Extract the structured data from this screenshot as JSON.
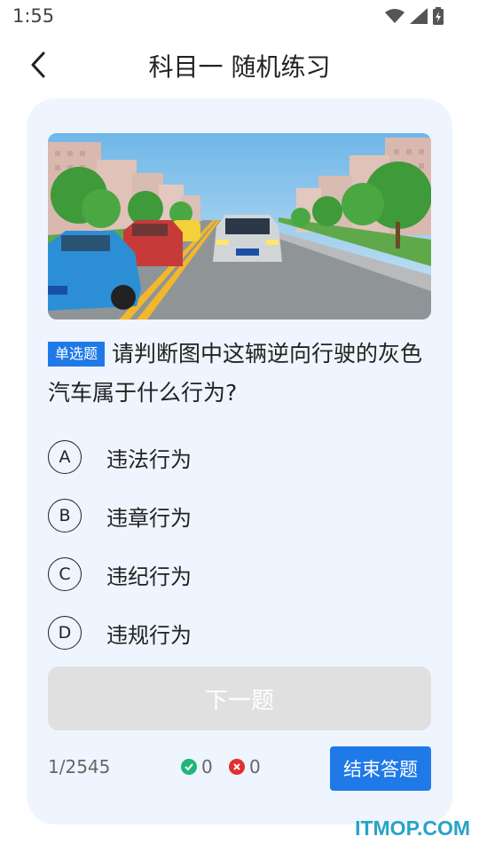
{
  "status_bar": {
    "time": "1:55",
    "icons": [
      "wifi-icon",
      "signal-icon",
      "battery-icon"
    ]
  },
  "header": {
    "title": "科目一 随机练习",
    "back_icon": "chevron-left-icon"
  },
  "question": {
    "type_tag": "单选题",
    "text": "请判断图中这辆逆向行驶的灰色汽车属于什么行为?",
    "image": "road-scene-illustration",
    "options": [
      {
        "letter": "A",
        "text": "违法行为"
      },
      {
        "letter": "B",
        "text": "违章行为"
      },
      {
        "letter": "C",
        "text": "违纪行为"
      },
      {
        "letter": "D",
        "text": "违规行为"
      }
    ]
  },
  "next_button": {
    "label": "下一题"
  },
  "footer": {
    "progress": "1/2545",
    "correct_count": "0",
    "wrong_count": "0",
    "end_button": "结束答题"
  },
  "watermark": "ITMOP.COM",
  "colors": {
    "accent": "#1f7ae8",
    "card_bg": "#eef5fe",
    "correct": "#1fb67a",
    "wrong": "#e0302e",
    "disabled": "#e0e0e0"
  }
}
